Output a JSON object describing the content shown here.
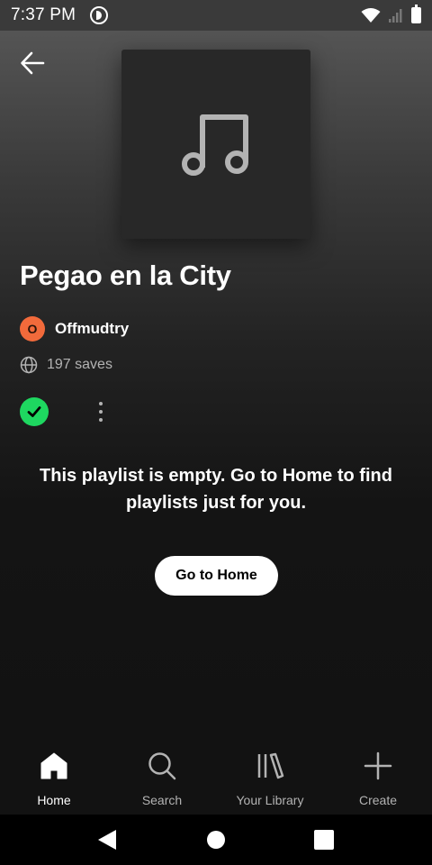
{
  "status_bar": {
    "time": "7:37 PM",
    "icons": [
      "app-notification-icon",
      "wifi-icon",
      "signal-icon",
      "battery-icon"
    ]
  },
  "header": {
    "back_icon": "arrow-left-icon",
    "cover_icon": "music-note-icon"
  },
  "playlist": {
    "title": "Pegao en la City",
    "owner_initial": "O",
    "owner_name": "Offmudtry",
    "saves": "197 saves",
    "empty_message": "This playlist is empty. Go to Home to find playlists just for you.",
    "go_home_label": "Go to Home"
  },
  "colors": {
    "accent_green": "#1ed760",
    "avatar_orange": "#f26a3b",
    "background": "#121212"
  },
  "bottom_nav": {
    "items": [
      {
        "label": "Home",
        "icon": "home-icon",
        "active": true
      },
      {
        "label": "Search",
        "icon": "search-icon",
        "active": false
      },
      {
        "label": "Your Library",
        "icon": "library-icon",
        "active": false
      },
      {
        "label": "Create",
        "icon": "plus-icon",
        "active": false
      }
    ]
  },
  "system_nav": {
    "icons": [
      "back-triangle-icon",
      "home-circle-icon",
      "recents-square-icon"
    ]
  }
}
